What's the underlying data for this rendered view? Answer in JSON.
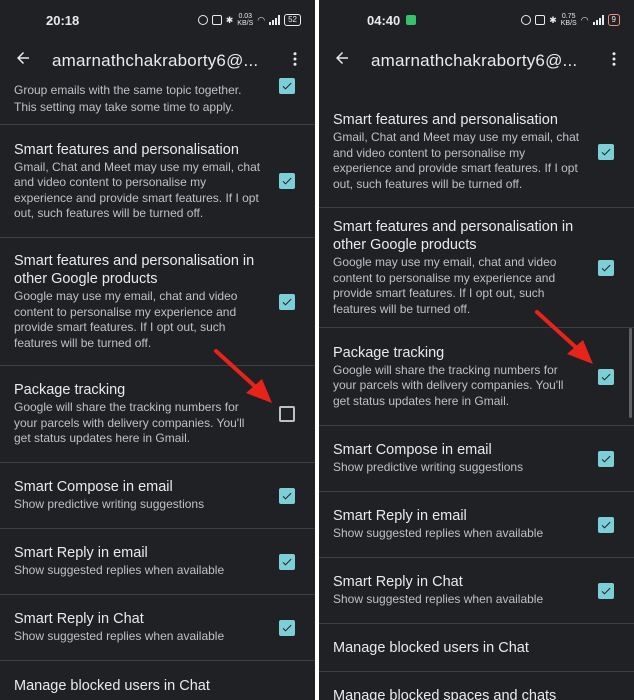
{
  "left": {
    "status": {
      "time": "20:18",
      "speed": "0.03\nKB/S",
      "battery": "52"
    },
    "toolbar": {
      "title": "amarnathchakraborty6@..."
    },
    "partial": {
      "line1": "Group emails with the same topic together.",
      "line2": "This setting may take some time to apply."
    },
    "items": [
      {
        "title": "Smart features and personalisation",
        "sub": "Gmail, Chat and Meet may use my email, chat and video content to personalise my experience and provide smart features. If I opt out, such features will be turned off.",
        "checked": true
      },
      {
        "title": "Smart features and personalisation in other Google products",
        "sub": "Google may use my email, chat and video content to personalise my experience and provide smart features. If I opt out, such features will be turned off.",
        "checked": true
      },
      {
        "title": "Package tracking",
        "sub": "Google will share the tracking numbers for your parcels with delivery companies. You'll get status updates here in Gmail.",
        "checked": false
      },
      {
        "title": "Smart Compose in email",
        "sub": "Show predictive writing suggestions",
        "checked": true
      },
      {
        "title": "Smart Reply in email",
        "sub": "Show suggested replies when available",
        "checked": true
      },
      {
        "title": "Smart Reply in Chat",
        "sub": "Show suggested replies when available",
        "checked": true
      },
      {
        "title": "Manage blocked users in Chat",
        "sub": "",
        "checked": null
      }
    ]
  },
  "right": {
    "status": {
      "time": "04:40",
      "speed": "0.75\nKB/S",
      "battery": "9"
    },
    "toolbar": {
      "title": "amarnathchakraborty6@..."
    },
    "items": [
      {
        "title": "Smart features and personalisation",
        "sub": "Gmail, Chat and Meet may use my email, chat and video content to personalise my experience and provide smart features. If I opt out, such features will be turned off.",
        "checked": true
      },
      {
        "title": "Smart features and personalisation in other Google products",
        "sub": "Google may use my email, chat and video content to personalise my experience and provide smart features. If I opt out, such features will be turned off.",
        "checked": true
      },
      {
        "title": "Package tracking",
        "sub": "Google will share the tracking numbers for your parcels with delivery companies. You'll get status updates here in Gmail.",
        "checked": true
      },
      {
        "title": "Smart Compose in email",
        "sub": "Show predictive writing suggestions",
        "checked": true
      },
      {
        "title": "Smart Reply in email",
        "sub": "Show suggested replies when available",
        "checked": true
      },
      {
        "title": "Smart Reply in Chat",
        "sub": "Show suggested replies when available",
        "checked": true
      },
      {
        "title": "Manage blocked users in Chat",
        "sub": "",
        "checked": null
      },
      {
        "title": "Manage blocked spaces and chats",
        "sub": "",
        "checked": null
      }
    ]
  },
  "colors": {
    "background": "#202124",
    "checkbox": "#7ccfd6",
    "arrow": "#e8231a",
    "divider": "#3c4043"
  },
  "icons": {
    "back": "arrow-left-icon",
    "more": "more-vert-icon",
    "check": "checkmark-icon"
  }
}
